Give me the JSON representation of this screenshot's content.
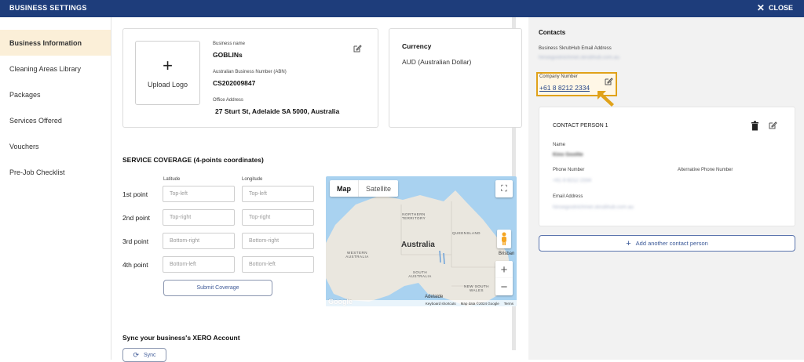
{
  "header": {
    "title": "BUSINESS SETTINGS",
    "close_label": "CLOSE"
  },
  "sidebar": {
    "items": [
      {
        "label": "Business Information",
        "active": true
      },
      {
        "label": "Cleaning Areas Library"
      },
      {
        "label": "Packages"
      },
      {
        "label": "Services Offered"
      },
      {
        "label": "Vouchers"
      },
      {
        "label": "Pre-Job Checklist"
      }
    ]
  },
  "business": {
    "upload_logo": "Upload Logo",
    "name_label": "Business name",
    "name_value": "GOBLINs",
    "abn_label": "Australian Business Number (ABN)",
    "abn_value": "CS202009847",
    "address_label": "Office Address",
    "address_value": "27 Sturt St, Adelaide SA 5000, Australia"
  },
  "currency": {
    "title": "Currency",
    "value": "AUD (Australian Dollar)"
  },
  "coverage": {
    "title": "SERVICE COVERAGE (4-points coordinates)",
    "lat_label": "Latitude",
    "lng_label": "Longitude",
    "points": [
      {
        "label": "1st point",
        "lat_placeholder": "Top-left",
        "lng_placeholder": "Top-left"
      },
      {
        "label": "2nd point",
        "lat_placeholder": "Top-right",
        "lng_placeholder": "Top-right"
      },
      {
        "label": "3rd point",
        "lat_placeholder": "Bottom-right",
        "lng_placeholder": "Bottom-right"
      },
      {
        "label": "4th point",
        "lat_placeholder": "Bottom-left",
        "lng_placeholder": "Bottom-left"
      }
    ],
    "submit_label": "Submit Coverage"
  },
  "map": {
    "tab_map": "Map",
    "tab_satellite": "Satellite",
    "nt": "NORTHERN TERRITORY",
    "qld": "QUEENSLAND",
    "wa": "WESTERN AUSTRALIA",
    "sa": "SOUTH AUSTRALIA",
    "nsw": "NEW SOUTH WALES",
    "country": "Australia",
    "brisbane": "Brisban",
    "adelaide": "Adelaide",
    "shortcuts": "Keyboard shortcuts",
    "map_data": "Map data ©2024 Google",
    "terms": "Terms",
    "google": "Google",
    "plus": "+",
    "minus": "−"
  },
  "xero": {
    "title": "Sync your business's XERO Account",
    "sync_label": "Sync"
  },
  "contacts": {
    "title": "Contacts",
    "email_label": "Business SkrubHub Email Address",
    "email_value": "hinoegootnichmet.skrubhub.com.au",
    "company_number_label": "Company Number",
    "company_number_value": "+61 8 8212 2334",
    "person": {
      "heading": "CONTACT PERSON 1",
      "name_label": "Name",
      "name_value": "Kino Goolite",
      "phone_label": "Phone Number",
      "phone_value": "+61 8 8212 2334",
      "alt_phone_label": "Alternative Phone Number",
      "email_label": "Email Address",
      "email_value": "hinoegootnichmet.skrubhub.com.au"
    },
    "add_label": "Add another contact person"
  },
  "colors": {
    "header_bg": "#1e3d7b",
    "active_nav_bg": "#fbefd8",
    "highlight": "#e0a21a",
    "link": "#2b4a8a"
  }
}
